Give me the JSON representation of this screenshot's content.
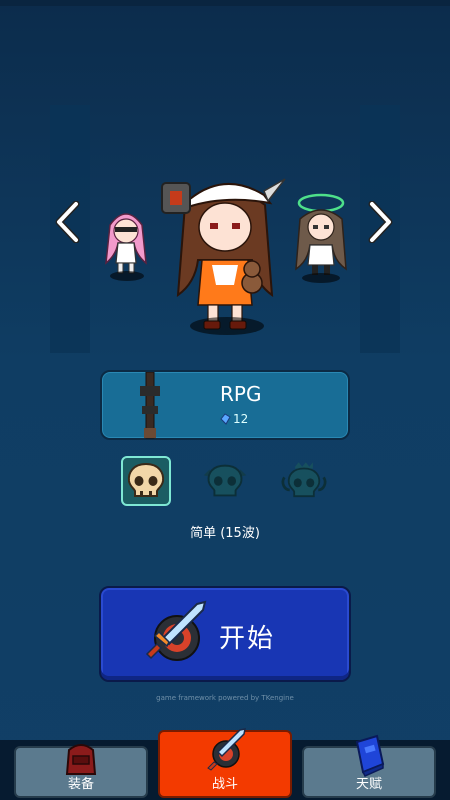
{
  "weapon": {
    "name": "RPG",
    "cost": "12"
  },
  "difficulty": {
    "options": [
      "easy-skull-icon",
      "normal-skull-icon",
      "hard-skull-icon"
    ],
    "selected_index": 0,
    "label": "简单 (15波)"
  },
  "start_button": {
    "label": "开始"
  },
  "footer": {
    "powered_by": "game framework powered by TKengine"
  },
  "nav": {
    "tabs": [
      {
        "label": "装备",
        "icon": "backpack-icon"
      },
      {
        "label": "战斗",
        "icon": "sword-icon"
      },
      {
        "label": "天赋",
        "icon": "spellbook-icon"
      }
    ],
    "active_index": 1
  },
  "colors": {
    "background": "#0f3d63",
    "panel": "#186d96",
    "start_button": "#1836b4",
    "active_tab": "#f33a00",
    "inactive_tab": "#5b7a8e",
    "selected_outline": "#7fe8d4"
  }
}
